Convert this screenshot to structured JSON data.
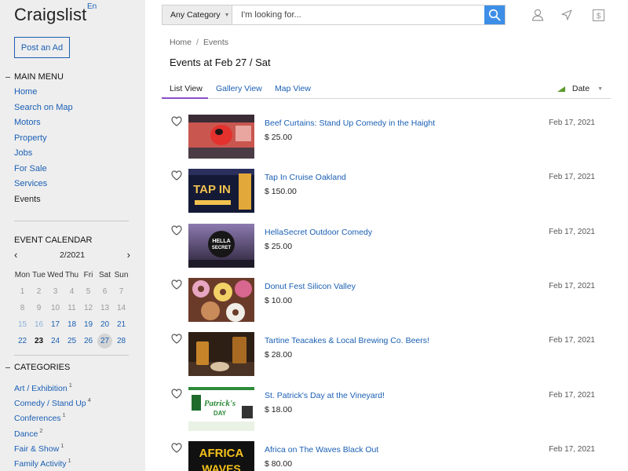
{
  "brand": {
    "name": "Craigslist",
    "lang": "En"
  },
  "sidebar": {
    "post_ad": "Post an Ad",
    "main_menu": {
      "title": "MAIN MENU",
      "items": [
        {
          "label": "Home"
        },
        {
          "label": "Search on Map"
        },
        {
          "label": "Motors"
        },
        {
          "label": "Property"
        },
        {
          "label": "Jobs"
        },
        {
          "label": "For Sale"
        },
        {
          "label": "Services"
        },
        {
          "label": "Events"
        }
      ],
      "current": "Events"
    },
    "calendar": {
      "title": "EVENT CALENDAR",
      "month": "2/2021",
      "weekdays": [
        "Mon",
        "Tue",
        "Wed",
        "Thu",
        "Fri",
        "Sat",
        "Sun"
      ],
      "weeks": [
        [
          "1",
          "2",
          "3",
          "4",
          "5",
          "6",
          "7"
        ],
        [
          "8",
          "9",
          "10",
          "11",
          "12",
          "13",
          "14"
        ],
        [
          "15",
          "16",
          "17",
          "18",
          "19",
          "20",
          "21"
        ],
        [
          "22",
          "23",
          "24",
          "25",
          "26",
          "27",
          "28"
        ]
      ],
      "today": "23",
      "selected": "27"
    },
    "categories": {
      "title": "CATEGORIES",
      "items": [
        {
          "label": "Art / Exhibition",
          "count": "1"
        },
        {
          "label": "Comedy / Stand Up",
          "count": "4"
        },
        {
          "label": "Conferences",
          "count": "1"
        },
        {
          "label": "Dance",
          "count": "2"
        },
        {
          "label": "Fair & Show",
          "count": "1"
        },
        {
          "label": "Family Activity",
          "count": "1"
        }
      ]
    }
  },
  "search": {
    "category": "Any Category",
    "placeholder": "I'm looking for..."
  },
  "top_icons": [
    "user-icon",
    "location-arrow-icon",
    "dollar-icon"
  ],
  "breadcrumb": [
    "Home",
    "Events"
  ],
  "page_title": "Events at Feb 27 / Sat",
  "tabs": [
    {
      "label": "List View",
      "active": true
    },
    {
      "label": "Gallery View",
      "active": false
    },
    {
      "label": "Map View",
      "active": false
    }
  ],
  "sort": {
    "label": "Date"
  },
  "colors": {
    "accent": "#3d8ee6",
    "link": "#1a5fb4",
    "tab_underline": "#8a4fc9",
    "sidebar_bg": "#eeeeee"
  },
  "events": [
    {
      "title": "Beef Curtains: Stand Up Comedy in the Haight",
      "price": "$ 25.00",
      "date": "Feb 17, 2021"
    },
    {
      "title": "Tap In Cruise Oakland",
      "price": "$ 150.00",
      "date": "Feb 17, 2021"
    },
    {
      "title": "HellaSecret Outdoor Comedy",
      "price": "$ 25.00",
      "date": "Feb 17, 2021"
    },
    {
      "title": "Donut Fest Silicon Valley",
      "price": "$ 10.00",
      "date": "Feb 17, 2021"
    },
    {
      "title": "Tartine Teacakes & Local Brewing Co. Beers!",
      "price": "$ 28.00",
      "date": "Feb 17, 2021"
    },
    {
      "title": "St. Patrick's Day at the Vineyard!",
      "price": "$ 18.00",
      "date": "Feb 17, 2021"
    },
    {
      "title": "Africa on The Waves Black Out",
      "price": "$ 80.00",
      "date": "Feb 17, 2021"
    }
  ]
}
